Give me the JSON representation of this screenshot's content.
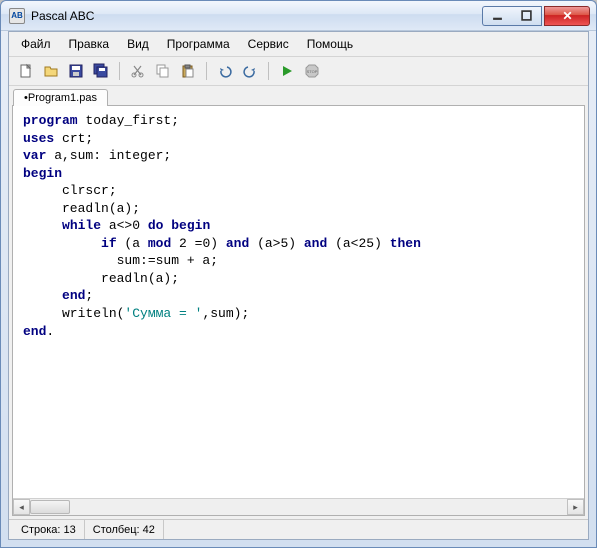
{
  "window": {
    "title": "Pascal ABC"
  },
  "menu": {
    "file": "Файл",
    "edit": "Правка",
    "view": "Вид",
    "program": "Программа",
    "service": "Сервис",
    "help": "Помощь"
  },
  "tabs": {
    "active": "•Program1.pas"
  },
  "code": {
    "lines": [
      {
        "indent": 0,
        "t": [
          {
            "k": "kw",
            "v": "program"
          },
          {
            "k": "",
            "v": " today_first;"
          }
        ]
      },
      {
        "indent": 0,
        "t": [
          {
            "k": "kw",
            "v": "uses"
          },
          {
            "k": "",
            "v": " crt;"
          }
        ]
      },
      {
        "indent": 0,
        "t": [
          {
            "k": "kw",
            "v": "var"
          },
          {
            "k": "",
            "v": " a,sum: integer;"
          }
        ]
      },
      {
        "indent": 0,
        "t": [
          {
            "k": "kw",
            "v": "begin"
          }
        ]
      },
      {
        "indent": 5,
        "t": [
          {
            "k": "",
            "v": "clrscr;"
          }
        ]
      },
      {
        "indent": 5,
        "t": [
          {
            "k": "",
            "v": "readln(a);"
          }
        ]
      },
      {
        "indent": 5,
        "t": [
          {
            "k": "kw",
            "v": "while"
          },
          {
            "k": "",
            "v": " a<>0 "
          },
          {
            "k": "kw",
            "v": "do begin"
          }
        ]
      },
      {
        "indent": 10,
        "t": [
          {
            "k": "kw",
            "v": "if"
          },
          {
            "k": "",
            "v": " (a "
          },
          {
            "k": "kw",
            "v": "mod"
          },
          {
            "k": "",
            "v": " 2 =0) "
          },
          {
            "k": "kw",
            "v": "and"
          },
          {
            "k": "",
            "v": " (a>5) "
          },
          {
            "k": "kw",
            "v": "and"
          },
          {
            "k": "",
            "v": " (a<25) "
          },
          {
            "k": "kw",
            "v": "then"
          }
        ]
      },
      {
        "indent": 12,
        "t": [
          {
            "k": "",
            "v": "sum:=sum + a;"
          }
        ]
      },
      {
        "indent": 10,
        "t": [
          {
            "k": "",
            "v": "readln(a);"
          }
        ]
      },
      {
        "indent": 5,
        "t": [
          {
            "k": "kw",
            "v": "end"
          },
          {
            "k": "",
            "v": ";"
          }
        ]
      },
      {
        "indent": 5,
        "t": [
          {
            "k": "",
            "v": "writeln("
          },
          {
            "k": "str",
            "v": "'Сумма = '"
          },
          {
            "k": "",
            "v": ",sum);"
          }
        ]
      },
      {
        "indent": 0,
        "t": [
          {
            "k": "kw",
            "v": "end"
          },
          {
            "k": "",
            "v": "."
          }
        ]
      }
    ]
  },
  "status": {
    "line_label": "Строка:",
    "line_value": "13",
    "col_label": "Столбец:",
    "col_value": "42"
  }
}
